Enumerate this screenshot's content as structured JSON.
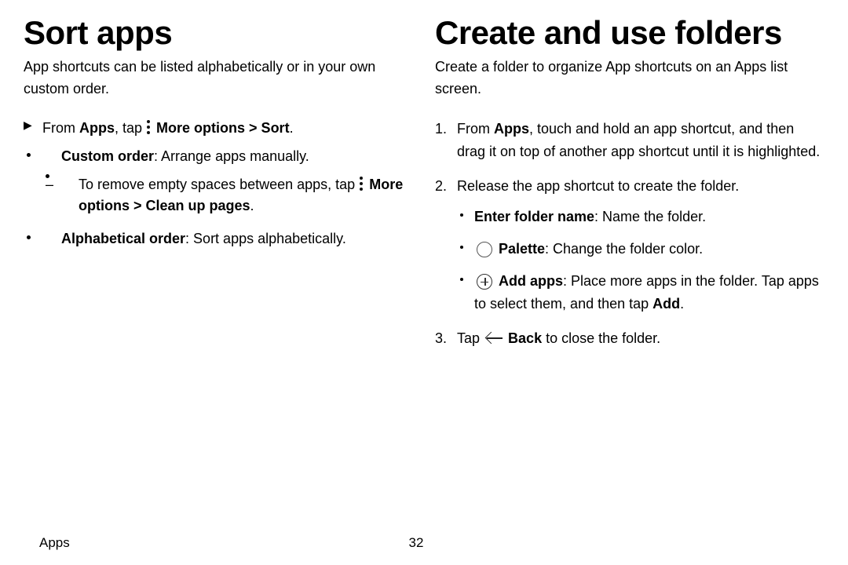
{
  "left": {
    "heading": "Sort apps",
    "intro": "App shortcuts can be listed alphabetically or in your own custom order.",
    "from_pre": "From ",
    "from_apps": "Apps",
    "from_mid": ", tap ",
    "more_options": "More options",
    "sort_path": " > Sort",
    "period": ".",
    "custom_bold": "Custom order",
    "custom_rest": ": Arrange apps manually.",
    "remove_pre": "To remove empty spaces between apps, tap ",
    "cleanup_path": " > Clean up pages",
    "alpha_bold": "Alphabetical order",
    "alpha_rest": ": Sort apps alphabetically."
  },
  "right": {
    "heading": "Create and use folders",
    "intro": "Create a folder to organize App shortcuts on an Apps list screen.",
    "s1_pre": "From ",
    "s1_apps": "Apps",
    "s1_rest": ", touch and hold an app shortcut, and then drag it on top of another app shortcut until it is highlighted.",
    "s2": "Release the app shortcut to create the folder.",
    "enter_bold": "Enter folder name",
    "enter_rest": ": Name the folder.",
    "palette_bold": "Palette",
    "palette_rest": ": Change the folder color.",
    "add_bold": "Add apps",
    "add_mid": ": Place more apps in the folder. Tap apps to select them, and then tap ",
    "add_tail": "Add",
    "s3_pre": "Tap ",
    "s3_back": "Back",
    "s3_rest": " to close the folder."
  },
  "footer": {
    "section": "Apps",
    "page": "32"
  }
}
